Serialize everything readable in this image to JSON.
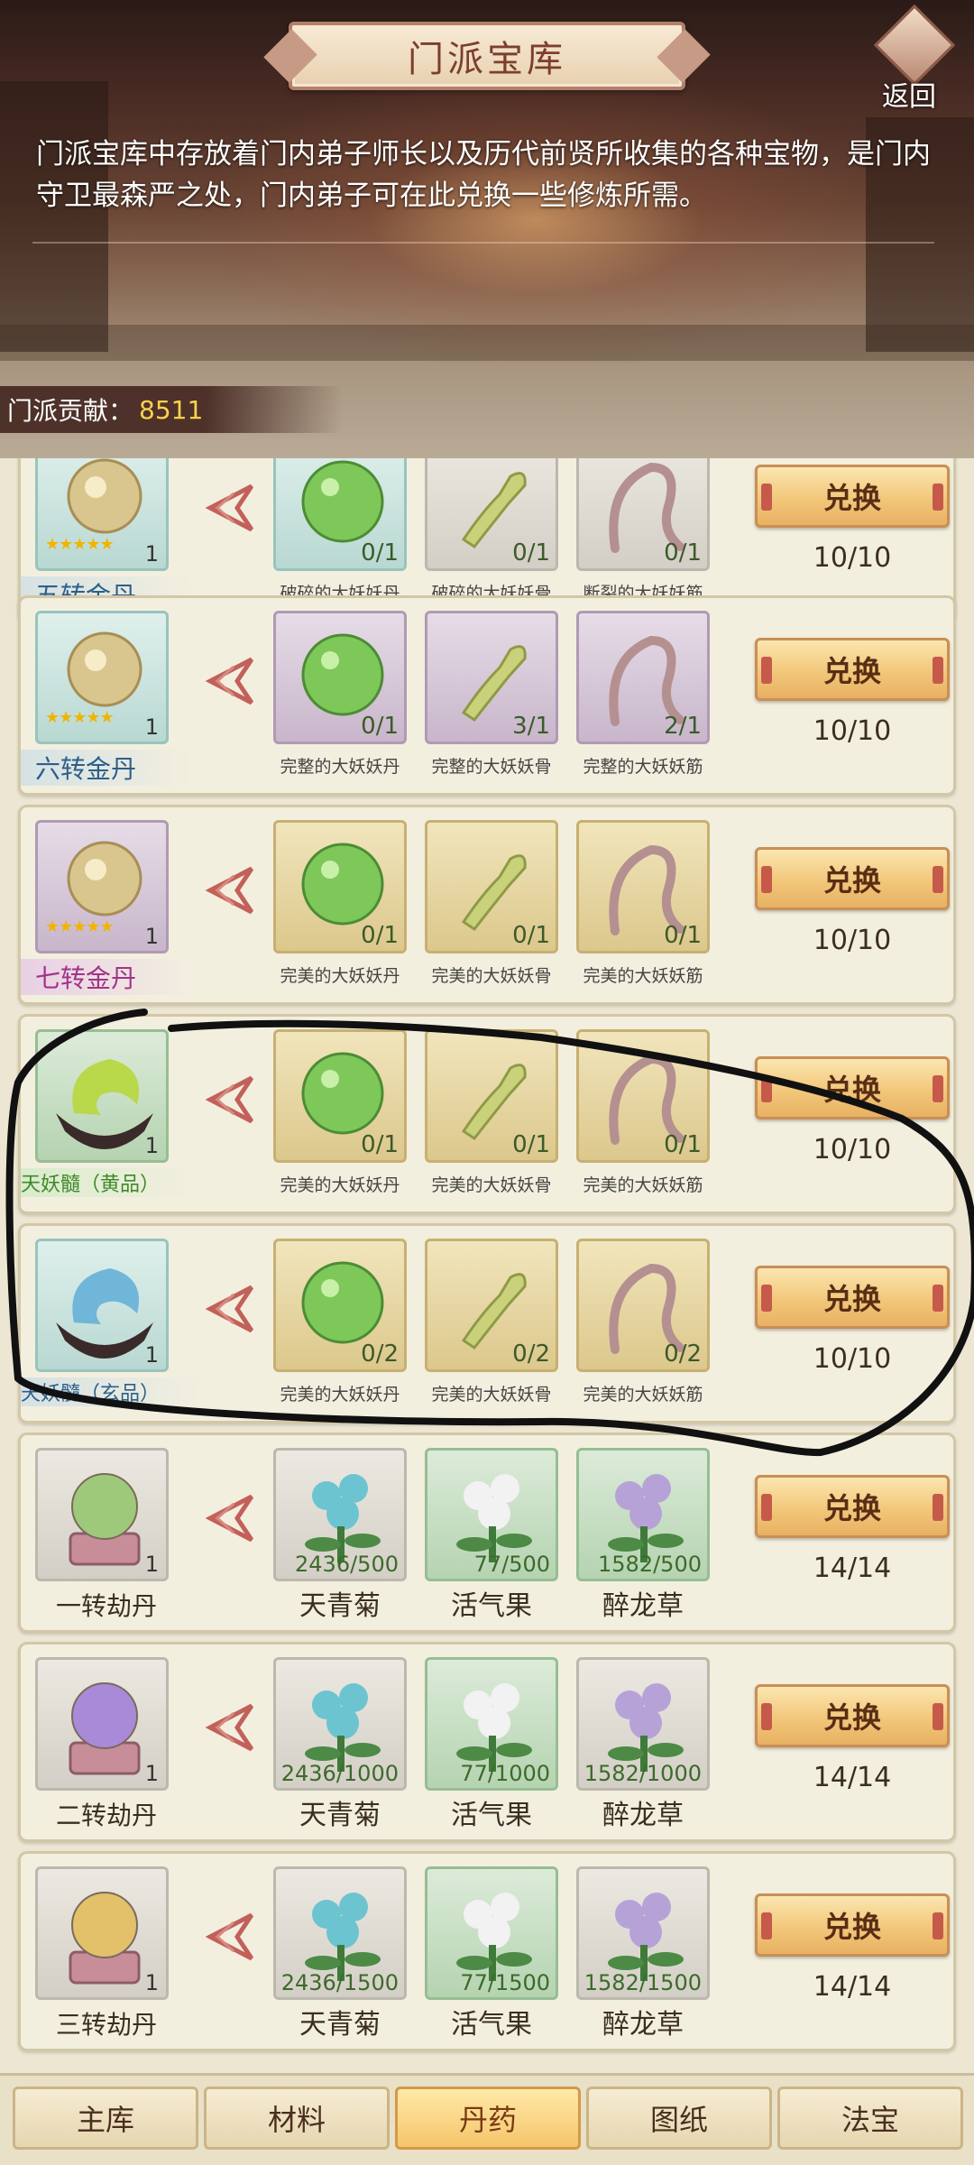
{
  "header": {
    "title": "门派宝库",
    "back_label": "返回",
    "intro_text": "门派宝库中存放着门内弟子师长以及历代前贤所收集的各种宝物，是门内守卫最森严之处，门内弟子可在此兑换一些修炼所需。",
    "contribution_label": "门派贡献：",
    "contribution_value": "8511"
  },
  "exchange": {
    "button_label": "兑换"
  },
  "rows": [
    {
      "result_name": "五转金丹",
      "result_count": "1",
      "limit": "10/10",
      "materials": [
        {
          "name": "破碎的大妖妖丹",
          "count": "0/1"
        },
        {
          "name": "破碎的大妖妖骨",
          "count": "0/1"
        },
        {
          "name": "断裂的大妖妖筋",
          "count": "0/1"
        }
      ]
    },
    {
      "result_name": "六转金丹",
      "result_count": "1",
      "limit": "10/10",
      "materials": [
        {
          "name": "完整的大妖妖丹",
          "count": "0/1"
        },
        {
          "name": "完整的大妖妖骨",
          "count": "3/1"
        },
        {
          "name": "完整的大妖妖筋",
          "count": "2/1"
        }
      ]
    },
    {
      "result_name": "七转金丹",
      "result_count": "1",
      "limit": "10/10",
      "materials": [
        {
          "name": "完美的大妖妖丹",
          "count": "0/1"
        },
        {
          "name": "完美的大妖妖骨",
          "count": "0/1"
        },
        {
          "name": "完美的大妖妖筋",
          "count": "0/1"
        }
      ]
    },
    {
      "result_name": "天妖髓（黄品）",
      "result_count": "1",
      "limit": "10/10",
      "materials": [
        {
          "name": "完美的大妖妖丹",
          "count": "0/1"
        },
        {
          "name": "完美的大妖妖骨",
          "count": "0/1"
        },
        {
          "name": "完美的大妖妖筋",
          "count": "0/1"
        }
      ]
    },
    {
      "result_name": "天妖髓（玄品）",
      "result_count": "1",
      "limit": "10/10",
      "materials": [
        {
          "name": "完美的大妖妖丹",
          "count": "0/2"
        },
        {
          "name": "完美的大妖妖骨",
          "count": "0/2"
        },
        {
          "name": "完美的大妖妖筋",
          "count": "0/2"
        }
      ]
    },
    {
      "result_name": "一转劫丹",
      "result_count": "1",
      "limit": "14/14",
      "materials": [
        {
          "name": "天青菊",
          "count": "2436/500"
        },
        {
          "name": "活气果",
          "count": "77/500"
        },
        {
          "name": "醉龙草",
          "count": "1582/500"
        }
      ]
    },
    {
      "result_name": "二转劫丹",
      "result_count": "1",
      "limit": "14/14",
      "materials": [
        {
          "name": "天青菊",
          "count": "2436/1000"
        },
        {
          "name": "活气果",
          "count": "77/1000"
        },
        {
          "name": "醉龙草",
          "count": "1582/1000"
        }
      ]
    },
    {
      "result_name": "三转劫丹",
      "result_count": "1",
      "limit": "14/14",
      "materials": [
        {
          "name": "天青菊",
          "count": "2436/1500"
        },
        {
          "name": "活气果",
          "count": "77/1500"
        },
        {
          "name": "醉龙草",
          "count": "1582/1500"
        }
      ]
    }
  ],
  "tabs": [
    {
      "label": "主库",
      "active": false
    },
    {
      "label": "材料",
      "active": false
    },
    {
      "label": "丹药",
      "active": true
    },
    {
      "label": "图纸",
      "active": false
    },
    {
      "label": "法宝",
      "active": false
    }
  ],
  "colors": {
    "contribution_value": "#ffd24d",
    "name_blue": "#2c5f8a",
    "name_purple": "#a2338a",
    "name_green": "#3f8a2a",
    "name_dark": "#3a2e22",
    "count_green": "#3c6a2a",
    "scribble": "#111111"
  }
}
